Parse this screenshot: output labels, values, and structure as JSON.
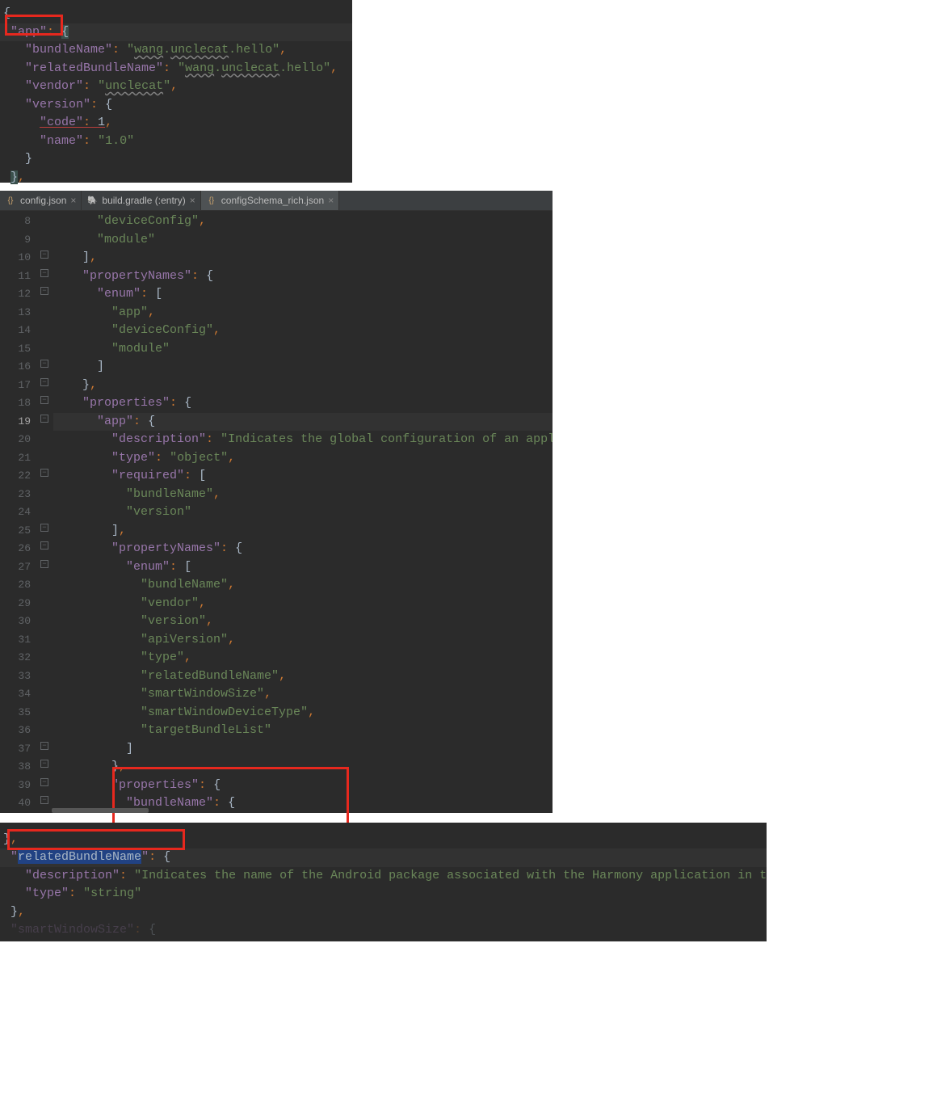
{
  "panel1": {
    "lines": [
      {
        "pre": "",
        "tokens": [
          [
            "{",
            "plain"
          ]
        ]
      },
      {
        "pre": " ",
        "tokens": [
          [
            "\"app\"",
            "key"
          ],
          [
            ":",
            "punc"
          ],
          [
            " ",
            "plain"
          ],
          [
            "{",
            "hlbrace"
          ]
        ],
        "hl": true
      },
      {
        "pre": "   ",
        "tokens": [
          [
            "\"bundleName\"",
            "key"
          ],
          [
            ":",
            "punc"
          ],
          [
            " ",
            "plain"
          ],
          [
            "\"",
            "str"
          ],
          [
            "wang",
            "str wavy"
          ],
          [
            ".",
            "str"
          ],
          [
            "unclecat",
            "str wavy"
          ],
          [
            ".hello\"",
            "str"
          ],
          [
            ",",
            "punc"
          ]
        ]
      },
      {
        "pre": "   ",
        "tokens": [
          [
            "\"relatedBundleName\"",
            "key"
          ],
          [
            ":",
            "punc"
          ],
          [
            " ",
            "plain"
          ],
          [
            "\"",
            "str"
          ],
          [
            "wang",
            "str wavy"
          ],
          [
            ".",
            "str"
          ],
          [
            "unclecat",
            "str wavy"
          ],
          [
            ".hello\"",
            "str"
          ],
          [
            ",",
            "punc"
          ]
        ]
      },
      {
        "pre": "   ",
        "tokens": [
          [
            "\"vendor\"",
            "key"
          ],
          [
            ":",
            "punc"
          ],
          [
            " ",
            "plain"
          ],
          [
            "\"",
            "str"
          ],
          [
            "unclecat",
            "str wavy"
          ],
          [
            "\"",
            "str"
          ],
          [
            ",",
            "punc"
          ]
        ]
      },
      {
        "pre": "   ",
        "tokens": [
          [
            "\"version\"",
            "key"
          ],
          [
            ":",
            "punc"
          ],
          [
            " ",
            "plain"
          ],
          [
            "{",
            "plain"
          ]
        ]
      },
      {
        "pre": "     ",
        "tokens": [
          [
            "\"code\"",
            "key errund"
          ],
          [
            ":",
            "punc errund"
          ],
          [
            " 1",
            "plain errund"
          ],
          [
            ",",
            "punc"
          ]
        ]
      },
      {
        "pre": "     ",
        "tokens": [
          [
            "\"name\"",
            "key"
          ],
          [
            ":",
            "punc"
          ],
          [
            " ",
            "plain"
          ],
          [
            "\"1.0\"",
            "str"
          ]
        ]
      },
      {
        "pre": "   ",
        "tokens": [
          [
            "}",
            "plain"
          ]
        ]
      },
      {
        "pre": " ",
        "tokens": [
          [
            "}",
            "hlbrace"
          ],
          [
            ",",
            "punc"
          ]
        ]
      }
    ]
  },
  "panel2": {
    "tabs": [
      {
        "label": "config.json",
        "icon": "json",
        "active": false
      },
      {
        "label": "build.gradle (:entry)",
        "icon": "gradle",
        "active": false
      },
      {
        "label": "configSchema_rich.json",
        "icon": "json2",
        "active": true
      }
    ],
    "startLine": 8,
    "lines": [
      {
        "n": 8,
        "pre": "      ",
        "tokens": [
          [
            "\"deviceConfig\"",
            "str"
          ],
          [
            ",",
            "punc"
          ]
        ]
      },
      {
        "n": 9,
        "pre": "      ",
        "tokens": [
          [
            "\"module\"",
            "str"
          ]
        ]
      },
      {
        "n": 10,
        "pre": "    ",
        "tokens": [
          [
            "]",
            "plain"
          ],
          [
            ",",
            "punc"
          ]
        ],
        "fold": "-"
      },
      {
        "n": 11,
        "pre": "    ",
        "tokens": [
          [
            "\"propertyNames\"",
            "key"
          ],
          [
            ":",
            "punc"
          ],
          [
            " ",
            "plain"
          ],
          [
            "{",
            "plain"
          ]
        ],
        "fold": "-"
      },
      {
        "n": 12,
        "pre": "      ",
        "tokens": [
          [
            "\"enum\"",
            "key"
          ],
          [
            ":",
            "punc"
          ],
          [
            " ",
            "plain"
          ],
          [
            "[",
            "plain"
          ]
        ],
        "fold": "-"
      },
      {
        "n": 13,
        "pre": "        ",
        "tokens": [
          [
            "\"app\"",
            "str"
          ],
          [
            ",",
            "punc"
          ]
        ]
      },
      {
        "n": 14,
        "pre": "        ",
        "tokens": [
          [
            "\"deviceConfig\"",
            "str"
          ],
          [
            ",",
            "punc"
          ]
        ]
      },
      {
        "n": 15,
        "pre": "        ",
        "tokens": [
          [
            "\"module\"",
            "str"
          ]
        ]
      },
      {
        "n": 16,
        "pre": "      ",
        "tokens": [
          [
            "]",
            "plain"
          ]
        ],
        "fold": "-"
      },
      {
        "n": 17,
        "pre": "    ",
        "tokens": [
          [
            "}",
            "plain"
          ],
          [
            ",",
            "punc"
          ]
        ],
        "fold": "-"
      },
      {
        "n": 18,
        "pre": "    ",
        "tokens": [
          [
            "\"properties\"",
            "key"
          ],
          [
            ":",
            "punc"
          ],
          [
            " ",
            "plain"
          ],
          [
            "{",
            "plain"
          ]
        ],
        "fold": "-"
      },
      {
        "n": 19,
        "pre": "      ",
        "tokens": [
          [
            "\"app\"",
            "key"
          ],
          [
            ":",
            "punc"
          ],
          [
            " ",
            "plain"
          ],
          [
            "{",
            "plain"
          ]
        ],
        "fold": "-",
        "hl": true
      },
      {
        "n": 20,
        "pre": "        ",
        "tokens": [
          [
            "\"description\"",
            "key"
          ],
          [
            ":",
            "punc"
          ],
          [
            " ",
            "plain"
          ],
          [
            "\"Indicates the global configuration of an applica",
            "str"
          ]
        ]
      },
      {
        "n": 21,
        "pre": "        ",
        "tokens": [
          [
            "\"type\"",
            "key"
          ],
          [
            ":",
            "punc"
          ],
          [
            " ",
            "plain"
          ],
          [
            "\"object\"",
            "str"
          ],
          [
            ",",
            "punc"
          ]
        ]
      },
      {
        "n": 22,
        "pre": "        ",
        "tokens": [
          [
            "\"required\"",
            "key"
          ],
          [
            ":",
            "punc"
          ],
          [
            " ",
            "plain"
          ],
          [
            "[",
            "plain"
          ]
        ],
        "fold": "-"
      },
      {
        "n": 23,
        "pre": "          ",
        "tokens": [
          [
            "\"bundleName\"",
            "str"
          ],
          [
            ",",
            "punc"
          ]
        ]
      },
      {
        "n": 24,
        "pre": "          ",
        "tokens": [
          [
            "\"version\"",
            "str"
          ]
        ]
      },
      {
        "n": 25,
        "pre": "        ",
        "tokens": [
          [
            "]",
            "plain"
          ],
          [
            ",",
            "punc"
          ]
        ],
        "fold": "-"
      },
      {
        "n": 26,
        "pre": "        ",
        "tokens": [
          [
            "\"propertyNames\"",
            "key"
          ],
          [
            ":",
            "punc"
          ],
          [
            " ",
            "plain"
          ],
          [
            "{",
            "plain"
          ]
        ],
        "fold": "-"
      },
      {
        "n": 27,
        "pre": "          ",
        "tokens": [
          [
            "\"enum\"",
            "key"
          ],
          [
            ":",
            "punc"
          ],
          [
            " ",
            "plain"
          ],
          [
            "[",
            "plain"
          ]
        ],
        "fold": "-"
      },
      {
        "n": 28,
        "pre": "            ",
        "tokens": [
          [
            "\"bundleName\"",
            "str"
          ],
          [
            ",",
            "punc"
          ]
        ]
      },
      {
        "n": 29,
        "pre": "            ",
        "tokens": [
          [
            "\"vendor\"",
            "str"
          ],
          [
            ",",
            "punc"
          ]
        ]
      },
      {
        "n": 30,
        "pre": "            ",
        "tokens": [
          [
            "\"version\"",
            "str"
          ],
          [
            ",",
            "punc"
          ]
        ]
      },
      {
        "n": 31,
        "pre": "            ",
        "tokens": [
          [
            "\"apiVersion\"",
            "str"
          ],
          [
            ",",
            "punc"
          ]
        ]
      },
      {
        "n": 32,
        "pre": "            ",
        "tokens": [
          [
            "\"type\"",
            "str"
          ],
          [
            ",",
            "punc"
          ]
        ]
      },
      {
        "n": 33,
        "pre": "            ",
        "tokens": [
          [
            "\"relatedBundleName\"",
            "str"
          ],
          [
            ",",
            "punc"
          ]
        ]
      },
      {
        "n": 34,
        "pre": "            ",
        "tokens": [
          [
            "\"smartWindowSize\"",
            "str"
          ],
          [
            ",",
            "punc"
          ]
        ]
      },
      {
        "n": 35,
        "pre": "            ",
        "tokens": [
          [
            "\"smartWindowDeviceType\"",
            "str"
          ],
          [
            ",",
            "punc"
          ]
        ]
      },
      {
        "n": 36,
        "pre": "            ",
        "tokens": [
          [
            "\"targetBundleList\"",
            "str"
          ]
        ]
      },
      {
        "n": 37,
        "pre": "          ",
        "tokens": [
          [
            "]",
            "plain"
          ]
        ],
        "fold": "-"
      },
      {
        "n": 38,
        "pre": "        ",
        "tokens": [
          [
            "}",
            "plain"
          ],
          [
            ",",
            "punc"
          ]
        ],
        "fold": "-"
      },
      {
        "n": 39,
        "pre": "        ",
        "tokens": [
          [
            "\"properties\"",
            "key"
          ],
          [
            ":",
            "punc"
          ],
          [
            " ",
            "plain"
          ],
          [
            "{",
            "plain"
          ]
        ],
        "fold": "-"
      },
      {
        "n": 40,
        "pre": "          ",
        "tokens": [
          [
            "\"bundleName\"",
            "key"
          ],
          [
            ":",
            "punc"
          ],
          [
            " ",
            "plain"
          ],
          [
            "{",
            "plain"
          ]
        ],
        "fold": "-"
      }
    ]
  },
  "panel3": {
    "lines": [
      {
        "pre": "",
        "tokens": [
          [
            "}",
            "plain"
          ],
          [
            ",",
            "punc"
          ]
        ]
      },
      {
        "pre": " ",
        "tokens": [
          [
            "\"",
            "key"
          ],
          [
            "relatedBundleName",
            "key sel"
          ],
          [
            "\"",
            "key"
          ],
          [
            ":",
            "punc"
          ],
          [
            " ",
            "plain"
          ],
          [
            "{",
            "plain"
          ]
        ],
        "hl": true
      },
      {
        "pre": "   ",
        "tokens": [
          [
            "\"description\"",
            "key"
          ],
          [
            ":",
            "punc"
          ],
          [
            " ",
            "plain"
          ],
          [
            "\"Indicates the name of the Android package associated with the Harmony application in the ",
            "str"
          ]
        ]
      },
      {
        "pre": "   ",
        "tokens": [
          [
            "\"type\"",
            "key"
          ],
          [
            ":",
            "punc"
          ],
          [
            " ",
            "plain"
          ],
          [
            "\"string\"",
            "str"
          ]
        ]
      },
      {
        "pre": " ",
        "tokens": [
          [
            "}",
            "plain"
          ],
          [
            ",",
            "punc"
          ]
        ]
      },
      {
        "pre": " ",
        "tokens": [
          [
            "\"smartWindowSize\"",
            "key faint"
          ],
          [
            ":",
            "punc faint"
          ],
          [
            " ",
            "plain"
          ],
          [
            "{",
            "plain faint"
          ]
        ]
      }
    ]
  }
}
